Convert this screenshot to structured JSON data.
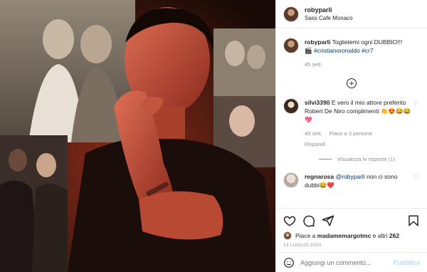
{
  "post": {
    "username": "robyparli",
    "location": "Sass Cafe Monaco"
  },
  "caption": {
    "username": "robyparli",
    "text": "Toglietemi ogni DUBBIO!!!",
    "emoji": "🎬",
    "hashtags": "#cristianoronaldo #cr7",
    "time": "45 sett."
  },
  "comments": [
    {
      "username": "silvi3390",
      "text": "E vero il mio attore preferito Robert De Niro complimenti",
      "emojis": "👏😍😂😂💖",
      "time": "45 sett.",
      "likes": "Piace a 3 persone",
      "reply_label": "Rispondi",
      "view_replies": "Visualizza le risposte (1)"
    },
    {
      "username": "regnarosa",
      "mention": "@robyparli",
      "text": "non ci sono dubbi",
      "emojis": "😂❤️"
    }
  ],
  "likes": {
    "prefix": "Piace a",
    "user": "madamemargotmc",
    "suffix": "e altri",
    "count": "262"
  },
  "date": "13 LUGLIO 2020",
  "add_comment": {
    "placeholder": "Aggiungi un commento...",
    "publish_label": "Pubblica"
  },
  "icons": {
    "like": "heart-icon",
    "comment": "comment-icon",
    "share": "share-icon",
    "save": "bookmark-icon",
    "load_more": "plus-circle-icon",
    "emoji": "emoji-icon"
  },
  "colors": {
    "link": "#00376b",
    "muted": "#8e8e8e",
    "publish": "#b2dffc",
    "text": "#262626"
  }
}
